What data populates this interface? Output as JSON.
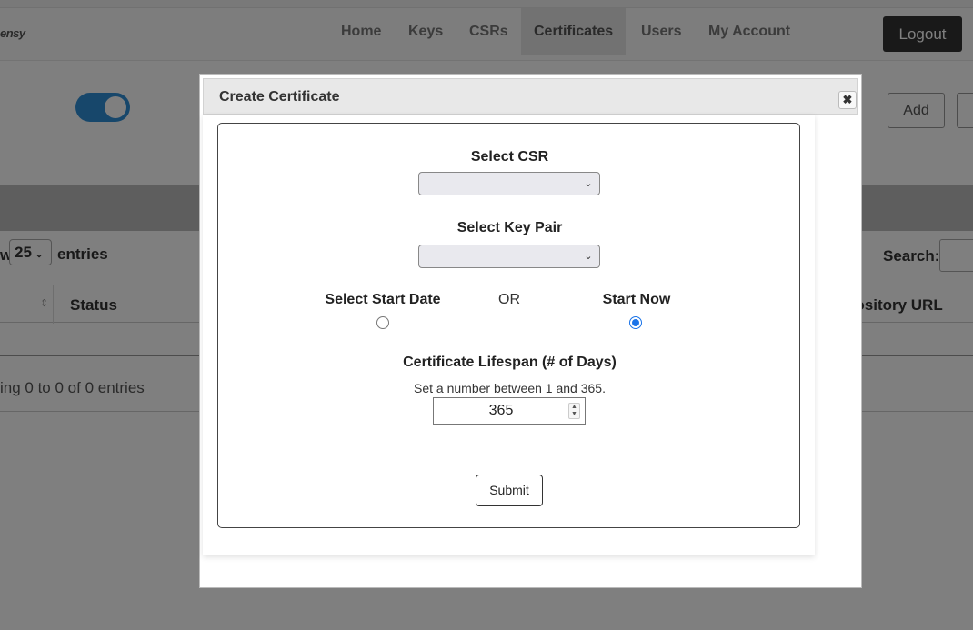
{
  "navbar": {
    "brand": "ensy",
    "items": [
      {
        "label": "Home"
      },
      {
        "label": "Keys"
      },
      {
        "label": "CSRs"
      },
      {
        "label": "Certificates"
      },
      {
        "label": "Users"
      },
      {
        "label": "My Account"
      }
    ],
    "active": "Certificates",
    "logout_label": "Logout"
  },
  "toolbar": {
    "toggle_on": true,
    "add_label": "Add"
  },
  "table": {
    "show_prefix": "w",
    "entries_value": "25",
    "entries_label": "entries",
    "search_label": "Search:",
    "columns": [
      "Status",
      "pository URL"
    ],
    "info": "ing 0 to 0 of 0 entries"
  },
  "modal": {
    "title": "Create Certificate",
    "close_icon": "close-x-icon",
    "select_csr_label": "Select CSR",
    "select_csr_value": "",
    "select_keypair_label": "Select Key Pair",
    "select_keypair_value": "",
    "start_date_label": "Select Start Date",
    "or_label": "OR",
    "start_now_label": "Start Now",
    "start_now_checked": true,
    "lifespan_label": "Certificate Lifespan (# of Days)",
    "lifespan_hint": "Set a number between 1 and 365.",
    "lifespan_value": "365",
    "submit_label": "Submit"
  },
  "colors": {
    "accent": "#2f8ed6",
    "radio_selected": "#1a73e8",
    "logout_bg": "#333333"
  }
}
